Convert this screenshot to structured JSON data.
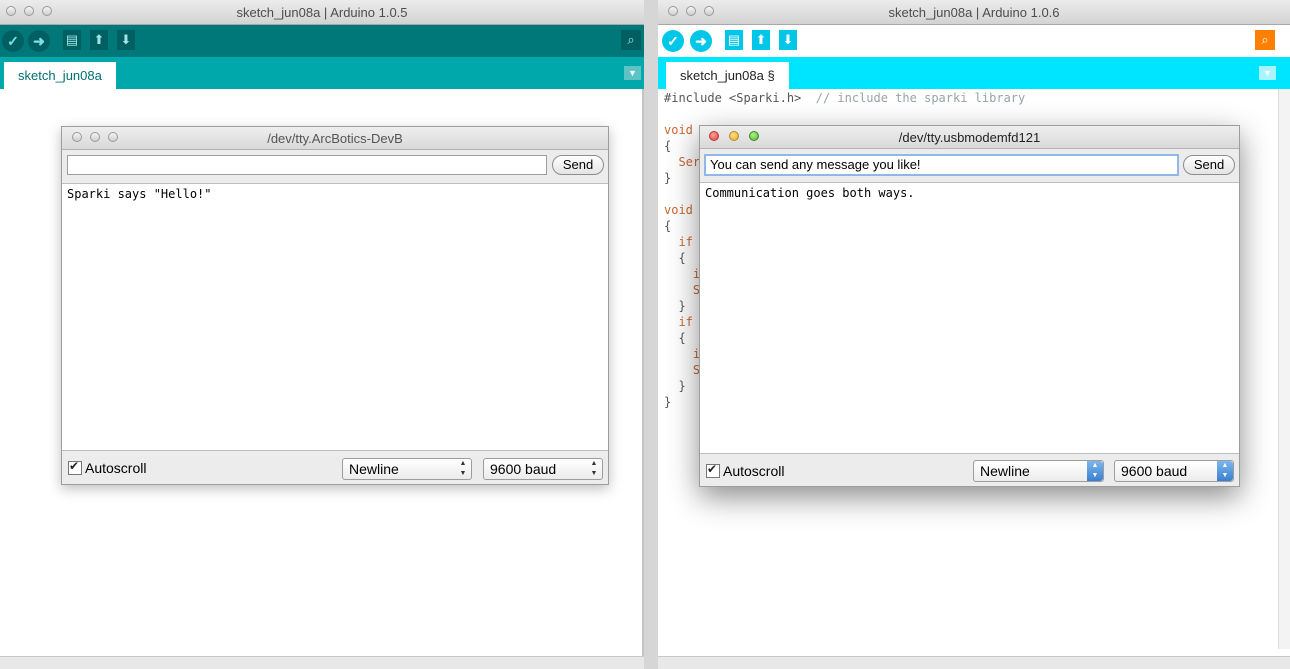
{
  "left_window": {
    "title": "sketch_jun08a | Arduino 1.0.5",
    "tab": "sketch_jun08a",
    "toolbar_icons": [
      "verify-icon",
      "upload-icon",
      "new-icon",
      "open-icon",
      "save-icon",
      "serial-monitor-icon"
    ],
    "colors": {
      "toolbar": "#00787a",
      "tabbar": "#00a8ab"
    }
  },
  "right_window": {
    "title": "sketch_jun08a | Arduino 1.0.6",
    "tab": "sketch_jun08a §",
    "toolbar_icons": [
      "verify-icon",
      "upload-icon",
      "new-icon",
      "open-icon",
      "save-icon",
      "serial-monitor-icon"
    ],
    "colors": {
      "tabbar": "#00e5ff",
      "buttons": "#00c6e8",
      "serial": "#ff7f00"
    },
    "code_lines": [
      {
        "a": "#include <Sparki.h>",
        "b": "// include the sparki library"
      },
      {
        "a": "",
        "b": ""
      },
      {
        "a": "void",
        "b": ""
      },
      {
        "a": "{",
        "b": ""
      },
      {
        "a": "  Ser",
        "b": ""
      },
      {
        "a": "}",
        "b": ""
      },
      {
        "a": "",
        "b": ""
      },
      {
        "a": "void",
        "b": ""
      },
      {
        "a": "{",
        "b": ""
      },
      {
        "a": "  if",
        "b": ""
      },
      {
        "a": "  {",
        "b": ""
      },
      {
        "a": "    i",
        "b": ""
      },
      {
        "a": "    S",
        "b": ""
      },
      {
        "a": "  }",
        "b": ""
      },
      {
        "a": "  if",
        "b": ""
      },
      {
        "a": "  {",
        "b": ""
      },
      {
        "a": "    i",
        "b": ""
      },
      {
        "a": "    S",
        "b": ""
      },
      {
        "a": "  }",
        "b": ""
      },
      {
        "a": "}",
        "b": ""
      }
    ]
  },
  "left_serial": {
    "title": "/dev/tty.ArcBotics-DevB",
    "input_value": "",
    "send_label": "Send",
    "output": "Sparki says \"Hello!\"",
    "autoscroll_label": "Autoscroll",
    "line_ending": "Newline",
    "baud": "9600 baud"
  },
  "right_serial": {
    "title": "/dev/tty.usbmodemfd121",
    "input_value": "You can send any message you like!",
    "send_label": "Send",
    "output": "Communication goes both ways.",
    "autoscroll_label": "Autoscroll",
    "line_ending": "Newline",
    "baud": "9600 baud"
  }
}
